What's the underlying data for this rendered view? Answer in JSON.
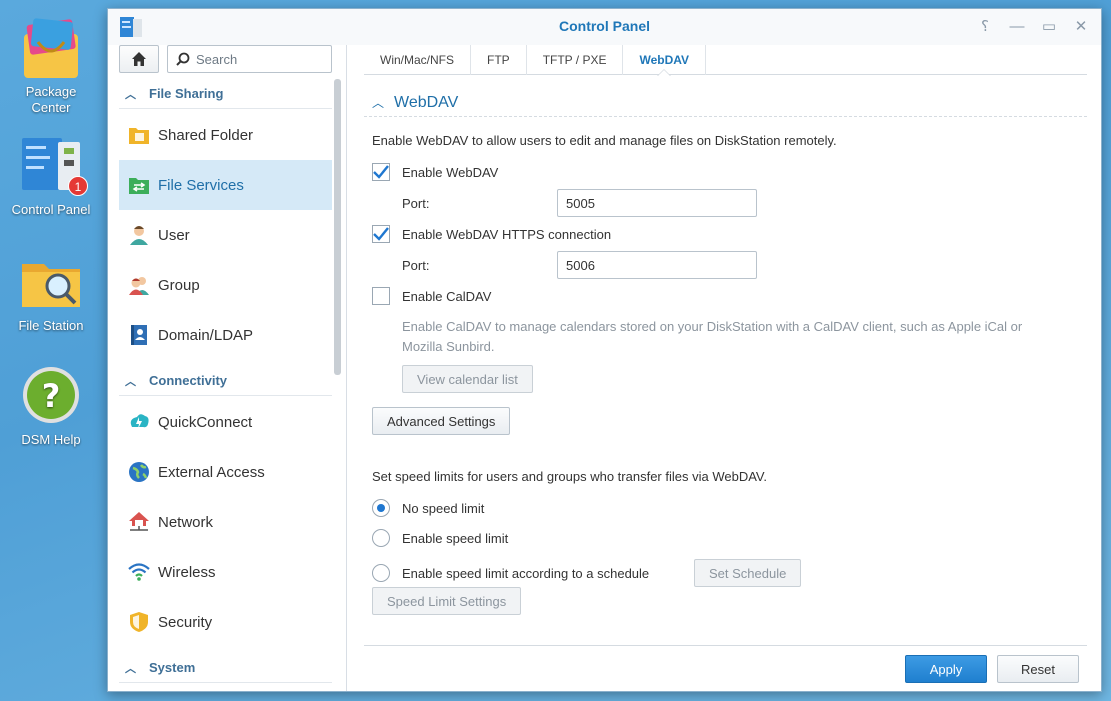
{
  "desktop": {
    "icons": [
      {
        "label_line1": "Package",
        "label_line2": "Center"
      },
      {
        "label": "Control Panel",
        "badge": "1"
      },
      {
        "label": "File Station"
      },
      {
        "label": "DSM Help"
      }
    ]
  },
  "window": {
    "title": "Control Panel",
    "controls": [
      "help-icon",
      "minimize-icon",
      "maximize-icon",
      "close-icon"
    ]
  },
  "sidebar": {
    "search_placeholder": "Search",
    "sections": [
      {
        "label": "File Sharing",
        "items": [
          {
            "label": "Shared Folder",
            "icon": "shared-folder-icon"
          },
          {
            "label": "File Services",
            "icon": "file-services-icon",
            "active": true
          },
          {
            "label": "User",
            "icon": "user-icon"
          },
          {
            "label": "Group",
            "icon": "group-icon"
          },
          {
            "label": "Domain/LDAP",
            "icon": "domain-ldap-icon"
          }
        ]
      },
      {
        "label": "Connectivity",
        "items": [
          {
            "label": "QuickConnect",
            "icon": "quickconnect-icon"
          },
          {
            "label": "External Access",
            "icon": "external-access-icon"
          },
          {
            "label": "Network",
            "icon": "network-icon"
          },
          {
            "label": "Wireless",
            "icon": "wireless-icon"
          },
          {
            "label": "Security",
            "icon": "security-icon"
          }
        ]
      },
      {
        "label": "System",
        "items": []
      }
    ]
  },
  "tabs": [
    {
      "label": "Win/Mac/NFS"
    },
    {
      "label": "FTP"
    },
    {
      "label": "TFTP / PXE"
    },
    {
      "label": "WebDAV",
      "active": true
    }
  ],
  "webdav": {
    "section_title": "WebDAV",
    "intro": "Enable WebDAV to allow users to edit and manage files on DiskStation remotely.",
    "enable_webdav": {
      "label": "Enable WebDAV",
      "checked": true
    },
    "port_label": "Port:",
    "port_value": "5005",
    "enable_https": {
      "label": "Enable WebDAV HTTPS connection",
      "checked": true
    },
    "https_port_label": "Port:",
    "https_port_value": "5006",
    "enable_caldav": {
      "label": "Enable CalDAV",
      "checked": false
    },
    "caldav_desc_line1": "Enable CalDAV to manage calendars stored on your DiskStation with a CalDAV client, such as Apple iCal or",
    "caldav_desc_line2": "Mozilla Sunbird.",
    "view_calendar_button": "View calendar list",
    "advanced_button": "Advanced Settings",
    "speed_intro": "Set speed limits for users and groups who transfer files via WebDAV.",
    "speed_options": [
      {
        "label": "No speed limit",
        "selected": true
      },
      {
        "label": "Enable speed limit",
        "selected": false
      },
      {
        "label": "Enable speed limit according to a schedule",
        "selected": false
      }
    ],
    "set_schedule_button": "Set Schedule",
    "speed_limit_settings_button": "Speed Limit Settings"
  },
  "footer": {
    "apply": "Apply",
    "reset": "Reset"
  },
  "colors": {
    "accent": "#1f77b8",
    "active_bg": "#d5e9f7",
    "primary_button": "#2a8ad8"
  }
}
